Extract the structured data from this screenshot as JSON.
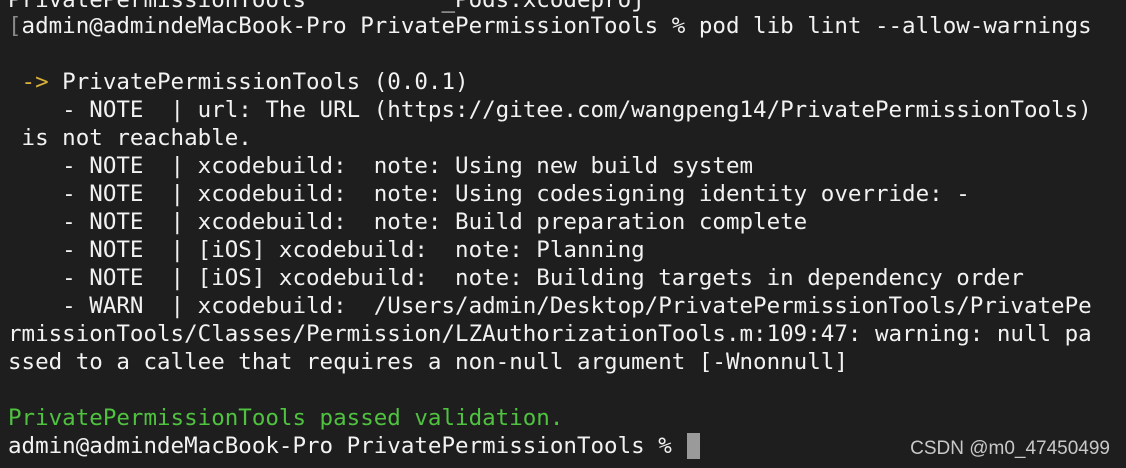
{
  "terminal": {
    "top_line_partial": "PrivatePermissionTools          _Pods.xcodeproj",
    "prompt": {
      "bracket": "[",
      "text": "admin@admindeMacBook-Pro PrivatePermissionTools %",
      "command": " pod lib lint --allow-warnings"
    },
    "pod": {
      "arrow": " ->",
      "name": " PrivatePermissionTools (0.0.1)"
    },
    "notes": [
      "    - NOTE  | url: The URL (https://gitee.com/wangpeng14/PrivatePermissionTools)",
      " is not reachable.",
      "    - NOTE  | xcodebuild:  note: Using new build system",
      "    - NOTE  | xcodebuild:  note: Using codesigning identity override: -",
      "    - NOTE  | xcodebuild:  note: Build preparation complete",
      "    - NOTE  | [iOS] xcodebuild:  note: Planning",
      "    - NOTE  | [iOS] xcodebuild:  note: Building targets in dependency order",
      "    - WARN  | xcodebuild:  /Users/admin/Desktop/PrivatePermissionTools/PrivatePe",
      "rmissionTools/Classes/Permission/LZAuthorizationTools.m:109:47: warning: null pa",
      "ssed to a callee that requires a non-null argument [-Wnonnull]"
    ],
    "result": "PrivatePermissionTools passed validation.",
    "final_prompt": "admin@admindeMacBook-Pro PrivatePermissionTools %",
    "colors": {
      "background": "#1e1e1e",
      "text": "#f2f2f2",
      "arrow": "#d9b13a",
      "success": "#4fc23f",
      "cursor": "#9a9a9a"
    }
  },
  "watermark": "CSDN @m0_47450499"
}
